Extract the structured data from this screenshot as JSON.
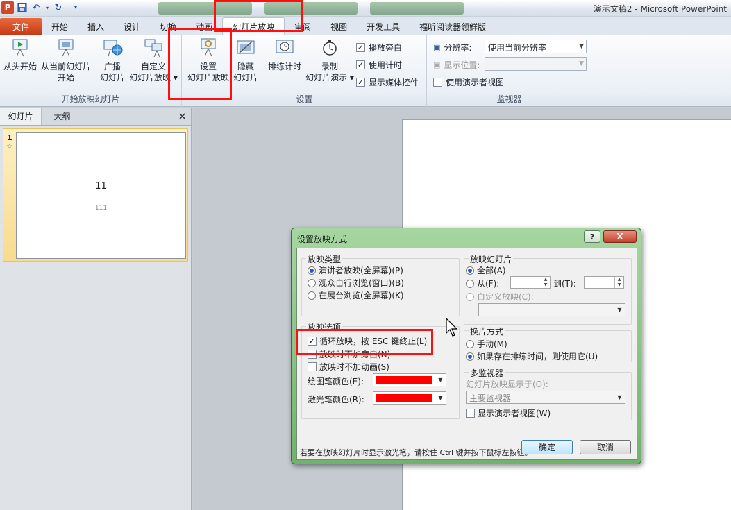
{
  "window": {
    "title": "演示文稿2 - Microsoft PowerPoint",
    "app_icon": "P"
  },
  "quick_access": {
    "icons": [
      "save-icon",
      "undo-icon",
      "redo-icon",
      "customize-icon"
    ]
  },
  "ribbon_tabs": [
    "文件",
    "开始",
    "插入",
    "设计",
    "切换",
    "动画",
    "幻灯片放映",
    "审阅",
    "视图",
    "开发工具",
    "福昕阅读器领鲜版"
  ],
  "active_tab": "幻灯片放映",
  "ribbon": {
    "group_start": {
      "label": "开始放映幻灯片",
      "btn_from_start": "从头开始",
      "btn_from_current_1": "从当前幻灯片",
      "btn_from_current_2": "开始",
      "btn_broadcast_1": "广播",
      "btn_broadcast_2": "幻灯片",
      "btn_custom_1": "自定义",
      "btn_custom_2": "幻灯片放映"
    },
    "group_setup": {
      "label": "设置",
      "btn_setup_1": "设置",
      "btn_setup_2": "幻灯片放映",
      "btn_hide_1": "隐藏",
      "btn_hide_2": "幻灯片",
      "btn_rehearse": "排练计时",
      "btn_record_1": "录制",
      "btn_record_2": "幻灯片演示",
      "chk_narration": "播放旁白",
      "chk_timing": "使用计时",
      "chk_media": "显示媒体控件"
    },
    "group_monitor": {
      "label": "监视器",
      "resolution_label": "分辨率:",
      "resolution_value": "使用当前分辨率",
      "display_label": "显示位置:",
      "presenter_view": "使用演示者视图"
    }
  },
  "left_panel": {
    "tab_slides": "幻灯片",
    "tab_outline": "大纲",
    "slide_number": "1",
    "thumb_title": "11",
    "thumb_sub": "111"
  },
  "dialog": {
    "title": "设置放映方式",
    "help": "?",
    "close": "X",
    "show_type": {
      "title": "放映类型",
      "opt1": "演讲者放映(全屏幕)(P)",
      "opt2": "观众自行浏览(窗口)(B)",
      "opt3": "在展台浏览(全屏幕)(K)"
    },
    "show_slides": {
      "title": "放映幻灯片",
      "all": "全部(A)",
      "from": "从(F):",
      "to": "到(T):",
      "custom": "自定义放映(C):"
    },
    "show_options": {
      "title": "放映选项",
      "loop": "循环放映，按 ESC 键终止(L)",
      "no_narration": "放映时不加旁白(N)",
      "no_animation": "放映时不加动画(S)",
      "pen_color": "绘图笔颜色(E):",
      "laser_color": "激光笔颜色(R):"
    },
    "advance": {
      "title": "换片方式",
      "manual": "手动(M)",
      "timings": "如果存在排练时间，则使用它(U)"
    },
    "multi_monitor": {
      "title": "多监视器",
      "display_on": "幻灯片放映显示于(O):",
      "monitor_value": "主要监视器",
      "presenter_view": "显示演示者视图(W)"
    },
    "note": "若要在放映幻灯片时显示激光笔，请按住 Ctrl 键并按下鼠标左按钮。",
    "ok": "确定",
    "cancel": "取消"
  },
  "colors": {
    "pen_color": "#ff0000",
    "laser_color": "#ff0000",
    "highlight": "#ff1010"
  }
}
